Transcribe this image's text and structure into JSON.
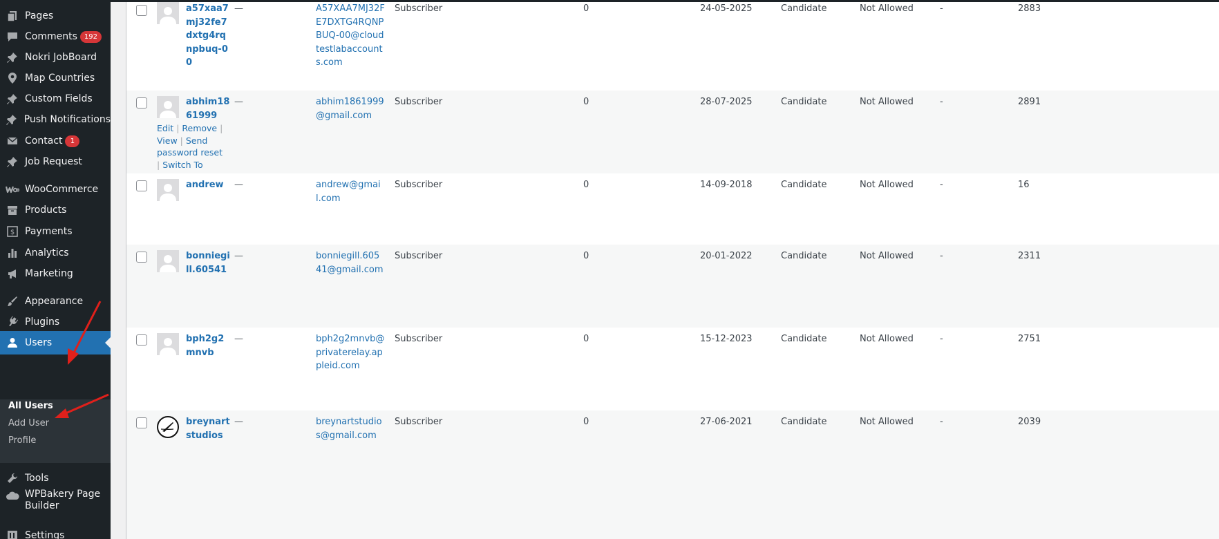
{
  "sidebar": {
    "items": [
      {
        "id": "pages",
        "label": "Pages",
        "icon": "pages-icon"
      },
      {
        "id": "comments",
        "label": "Comments",
        "badge": "192",
        "icon": "comments-icon"
      },
      {
        "id": "nokri",
        "label": "Nokri JobBoard",
        "icon": "pin-icon"
      },
      {
        "id": "map",
        "label": "Map Countries",
        "icon": "location-icon"
      },
      {
        "id": "custom-fields",
        "label": "Custom Fields",
        "icon": "pin-icon"
      },
      {
        "id": "push",
        "label": "Push Notifications",
        "icon": "pin-icon"
      },
      {
        "id": "contact",
        "label": "Contact",
        "badge": "1",
        "icon": "mail-icon"
      },
      {
        "id": "job-request",
        "label": "Job Request",
        "icon": "pin-icon"
      },
      {
        "id": "woocommerce",
        "label": "WooCommerce",
        "icon": "woocommerce-icon"
      },
      {
        "id": "products",
        "label": "Products",
        "icon": "archive-icon"
      },
      {
        "id": "payments",
        "label": "Payments",
        "icon": "dollar-icon"
      },
      {
        "id": "analytics",
        "label": "Analytics",
        "icon": "bar-chart-icon"
      },
      {
        "id": "marketing",
        "label": "Marketing",
        "icon": "megaphone-icon"
      },
      {
        "id": "appearance",
        "label": "Appearance",
        "icon": "paintbrush-icon"
      },
      {
        "id": "plugins",
        "label": "Plugins",
        "icon": "plug-icon"
      },
      {
        "id": "users",
        "label": "Users",
        "icon": "user-icon"
      },
      {
        "id": "tools",
        "label": "Tools",
        "icon": "wrench-icon"
      },
      {
        "id": "wpbakery",
        "label": "WPBakery Page Builder",
        "icon": "cloud-icon"
      },
      {
        "id": "settings",
        "label": "Settings",
        "icon": "settings-icon"
      }
    ],
    "users_submenu": [
      {
        "label": "All Users"
      },
      {
        "label": "Add User"
      },
      {
        "label": "Profile"
      }
    ]
  },
  "users_table": {
    "rows": [
      {
        "username": "a57xaa7mj32fe7dxtg4rqnpbuq-00",
        "name": "—",
        "email": "A57XAA7MJ32FE7DXTG4RQNPBUQ-00@cloudtestlabaccounts.com",
        "role": "Subscriber",
        "posts": "0",
        "date": "24-05-2025",
        "type": "Candidate",
        "status": "Not Allowed",
        "extra": "-",
        "id": "2883"
      },
      {
        "username": "abhim1861999",
        "name": "—",
        "email": "abhim1861999@gmail.com",
        "role": "Subscriber",
        "posts": "0",
        "date": "28-07-2025",
        "type": "Candidate",
        "status": "Not Allowed",
        "extra": "-",
        "id": "2891"
      },
      {
        "username": "andrew",
        "name": "—",
        "email": "andrew@gmail.com",
        "role": "Subscriber",
        "posts": "0",
        "date": "14-09-2018",
        "type": "Candidate",
        "status": "Not Allowed",
        "extra": "-",
        "id": "16"
      },
      {
        "username": "bonniegill.60541",
        "name": "—",
        "email": "bonniegill.60541@gmail.com",
        "role": "Subscriber",
        "posts": "0",
        "date": "20-01-2022",
        "type": "Candidate",
        "status": "Not Allowed",
        "extra": "-",
        "id": "2311"
      },
      {
        "username": "bph2g2mnvb",
        "name": "—",
        "email": "bph2g2mnvb@privaterelay.appleid.com",
        "role": "Subscriber",
        "posts": "0",
        "date": "15-12-2023",
        "type": "Candidate",
        "status": "Not Allowed",
        "extra": "-",
        "id": "2751"
      },
      {
        "username": "breynartstudios",
        "name": "—",
        "email": "breynartstudios@gmail.com",
        "role": "Subscriber",
        "posts": "0",
        "date": "27-06-2021",
        "type": "Candidate",
        "status": "Not Allowed",
        "extra": "-",
        "id": "2039"
      }
    ],
    "row_actions": {
      "edit": "Edit",
      "remove": "Remove",
      "view": "View",
      "send_reset": "Send password reset",
      "switch_to": "Switch To",
      "separator": "|"
    }
  },
  "colors": {
    "sidebar_bg": "#1d2327",
    "submenu_bg": "#2c3338",
    "accent": "#2271b1",
    "badge": "#d63638",
    "annotation_arrow": "#e0201b"
  }
}
